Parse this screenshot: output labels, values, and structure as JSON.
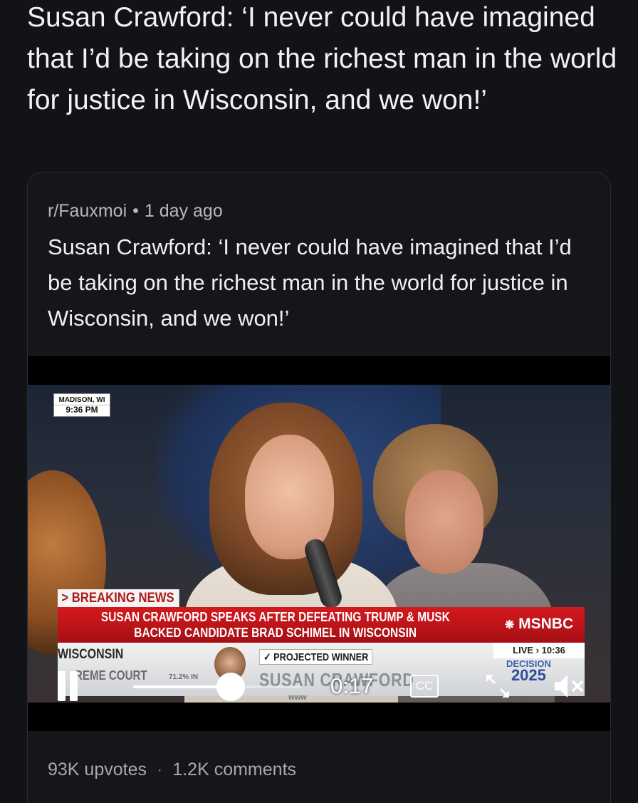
{
  "post": {
    "headline": "Susan Crawford: ‘I never could have imagined that I’d be taking on the richest man in the world for justice in Wisconsin, and we won!’"
  },
  "card": {
    "subreddit": "r/Fauxmoi",
    "separator": "•",
    "age": "1 day ago",
    "title": "Susan Crawford: ‘I never could have imagined that I’d be taking on the richest man in the world for justice in Wisconsin, and we won!’",
    "upvotes": "93K upvotes",
    "footer_separator": "·",
    "comments": "1.2K comments"
  },
  "video": {
    "location": "MADISON, WI",
    "local_time": "9:36 PM",
    "breaking_label": "> BREAKING NEWS",
    "ticker_line1": "SUSAN CRAWFORD SPEAKS AFTER DEFEATING TRUMP & MUSK",
    "ticker_line2": "BACKED CANDIDATE BRAD SCHIMEL IN WISCONSIN",
    "network": "MSNBC",
    "live_label": "LIVE › 10:36",
    "state": "WISCONSIN",
    "race": "REME COURT",
    "percent_in": "71.2% IN",
    "projected_label": "✓ PROJECTED WINNER",
    "winner_name": "SUSAN CRAWFORD",
    "www_text": "www",
    "decision_label": "DECISION",
    "decision_year": "2025",
    "elapsed": "0:17",
    "cc_label": "CC",
    "progress_fraction": 0.58,
    "accent_red": "#d3191f"
  },
  "icons": {
    "pause": "pause-icon",
    "cc": "closed-captions-icon",
    "fullscreen": "fullscreen-icon",
    "mute": "volume-muted-icon"
  }
}
